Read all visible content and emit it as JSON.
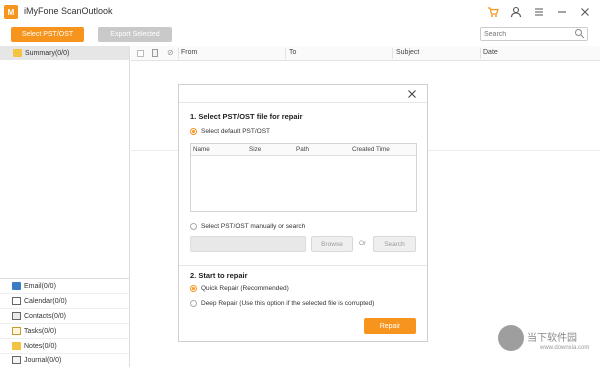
{
  "window": {
    "title": "iMyFone ScanOutlook",
    "logo_glyph": "M"
  },
  "toolbar": {
    "select_label": "Select PST/OST",
    "export_label": "Export Selected",
    "search_placeholder": "Search"
  },
  "sidebar": {
    "summary": "Summary(0/0)",
    "items": [
      {
        "label": "Email(0/0)",
        "icon": "email-icon"
      },
      {
        "label": "Calendar(0/0)",
        "icon": "calendar-icon"
      },
      {
        "label": "Contacts(0/0)",
        "icon": "contacts-icon"
      },
      {
        "label": "Tasks(0/0)",
        "icon": "tasks-icon"
      },
      {
        "label": "Notes(0/0)",
        "icon": "notes-icon"
      },
      {
        "label": "Journal(0/0)",
        "icon": "journal-icon"
      }
    ]
  },
  "list": {
    "columns": [
      "From",
      "To",
      "Subject",
      "Date"
    ]
  },
  "modal": {
    "section1_title": "1. Select PST/OST file for repair",
    "default_option": "Select default PST/OST",
    "table_columns": [
      "Name",
      "Size",
      "Path",
      "Created Time"
    ],
    "manual_option": "Select PST/OST manually or search",
    "browse_label": "Browse",
    "or_label": "Or",
    "search_label": "Search",
    "section2_title": "2. Start to repair",
    "quick_repair": "Quick Repair (Recommended)",
    "deep_repair": "Deep Repair (Use this option if the selected file is corrupted)",
    "repair_label": "Repair"
  },
  "watermark": {
    "line1": "当下软件园",
    "line2": "www.downxia.com"
  },
  "colors": {
    "accent": "#f7941d",
    "disabled": "#c9c9c9"
  }
}
